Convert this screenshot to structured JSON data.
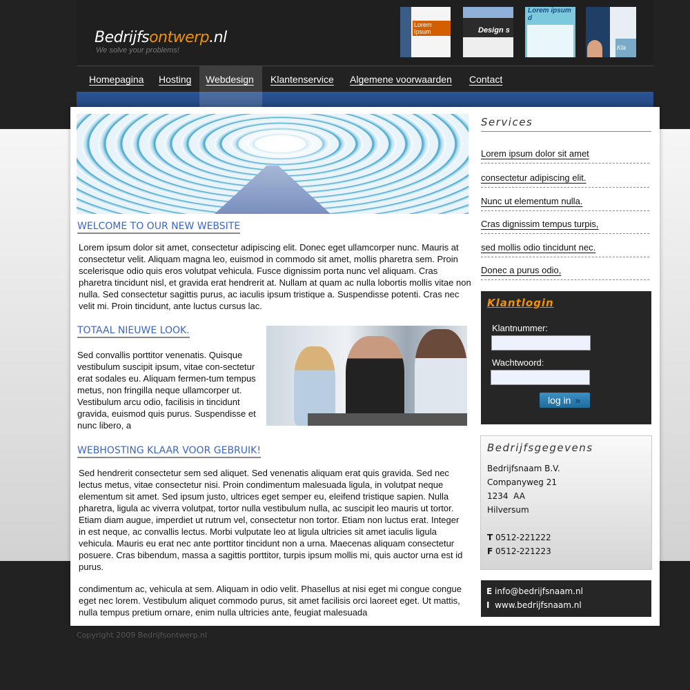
{
  "header": {
    "logo_part1": "Bedrijfs",
    "logo_part2": "ontwerp",
    "logo_part3": ".nl",
    "tagline": "We solve your problems!",
    "thumbnails": [
      {
        "label": "Lorem Ipsum"
      },
      {
        "label": "Design s"
      },
      {
        "label": "Lorem ipsum d"
      },
      {
        "label": "Kla"
      }
    ]
  },
  "nav": {
    "items": [
      {
        "label": "Homepagina"
      },
      {
        "label": "Hosting"
      },
      {
        "label": "Webdesign",
        "active": true
      },
      {
        "label": "Klantenservice"
      },
      {
        "label": "Algemene voorwaarden"
      },
      {
        "label": "Contact"
      }
    ]
  },
  "main": {
    "sections": [
      {
        "title": "WELCOME TO OUR NEW WEBSITE",
        "text": "Lorem ipsum dolor sit amet, consectetur adipiscing elit. Donec eget ullamcorper nunc. Mauris at consectetur velit. Aliquam magna leo, euismod in commodo sit amet, mollis pharetra sem. Proin scelerisque odio quis eros volutpat vehicula. Fusce dignissim porta nunc vel aliquam. Cras pharetra tincidunt nisl, et gravida erat hendrerit at. Nullam at quam ac nulla lobortis mollis vitae non nulla. Sed consectetur sagittis purus, ac iaculis ipsum tristique a. Suspendisse potenti. Cras nec velit mi. Proin tincidunt, ante luctus cursus lac."
      },
      {
        "title": "TOTAAL NIEUWE LOOK.",
        "text": "Sed convallis porttitor venenatis. Quisque vestibulum suscipit ipsum, vitae con-sectetur erat sodales eu. Aliquam fermen-tum tempus metus, non fringilla neque ullamcorper ut. Vestibulum arcu odio, facilisis in tincidunt gravida, euismod quis purus. Suspendisse et nunc libero, a"
      },
      {
        "title": "WEBHOSTING KLAAR VOOR GEBRUIK!",
        "text": "Sed hendrerit consectetur sem sed aliquet. Sed venenatis aliquam erat quis gravida. Sed nec lectus metus, vitae consectetur nisi. Proin condimentum malesuada ligula, in volutpat neque elementum sit amet. Sed ipsum justo, ultrices eget semper eu, eleifend tristique sapien. Nulla pharetra, ligula ac viverra volutpat, tortor nulla vestibulum nulla, ac suscipit leo mauris ut tortor. Etiam diam augue, imperdiet ut rutrum vel, consectetur non tortor. Etiam non luctus erat. Integer in est neque, ac convallis lectus. Morbi vulputate leo at ligula ultricies sit amet iaculis ligula vehicula. Mauris eu erat nec ante porttitor tincidunt non a urna. Maecenas aliquam consectetur posuere. Cras bibendum, massa a sagittis porttitor, turpis ipsum mollis mi, quis auctor urna est id purus.",
        "text2": "condimentum ac, vehicula at sem. Aliquam in odio velit. Phasellus at nisi eget mi congue congue eget nec lorem. Vestibulum aliquet commodo purus, sit amet facilisis orci laoreet eget. Ut mattis, nulla tempus pretium ornare, enim nulla ultricies ante, feugiat malesuada"
      }
    ]
  },
  "sidebar": {
    "services_title": "Services",
    "services": [
      "Lorem ipsum dolor sit amet",
      " consectetur adipiscing elit. ",
      "Nunc ut elementum nulla. ",
      "Cras dignissim tempus turpis, ",
      "sed mollis odio tincidunt nec. ",
      "Donec a purus odio,"
    ],
    "login": {
      "title": "Klantlogin",
      "customer_label": "Klantnummer:",
      "customer_value": "",
      "password_label": "Wachtwoord:",
      "password_value": "",
      "button_label": "log in",
      "button_icon": "double-chevron-right-icon"
    },
    "company": {
      "title": "Bedrijfsgegevens",
      "name": "Bedrijfsnaam B.V.",
      "street": "Companyweg 21",
      "postcode": "1234  AA",
      "city": "Hilversum",
      "phone_prefix": "T",
      "phone": "0512-221222",
      "fax_prefix": "F",
      "fax": "0512-221223"
    },
    "contact": {
      "email_prefix": "E",
      "email": "info@bedrijfsnaam.nl",
      "web_prefix": "I",
      "web": "www.bedrijfsnaam.nl"
    }
  },
  "footer": {
    "copyright": "Copyright 2009 Bedrijfsontwerp.nl"
  },
  "colors": {
    "accent_orange": "#f39200",
    "heading_blue": "#3b66c4",
    "nav_blue": "#2c5596",
    "dark": "#222222"
  }
}
